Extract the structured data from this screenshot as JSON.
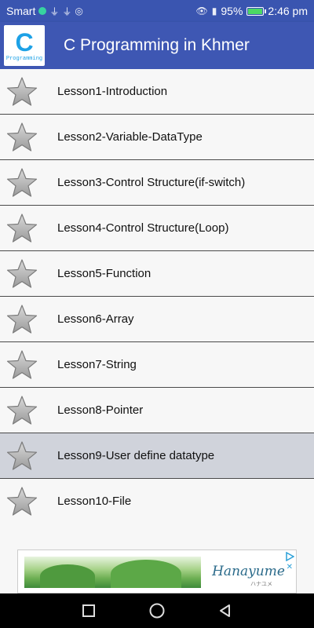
{
  "status_bar": {
    "carrier": "Smart",
    "battery_percent": "95%",
    "time": "2:46 pm",
    "battery_level": 0.95
  },
  "app_bar": {
    "logo_letter": "C",
    "logo_caption": "Programming",
    "title": "C Programming in Khmer"
  },
  "lessons": [
    {
      "label": "Lesson1-Introduction",
      "icon": "star-icon"
    },
    {
      "label": "Lesson2-Variable-DataType",
      "icon": "star-icon"
    },
    {
      "label": "Lesson3-Control Structure(if-switch)",
      "icon": "star-icon"
    },
    {
      "label": "Lesson4-Control Structure(Loop)",
      "icon": "star-icon"
    },
    {
      "label": "Lesson5-Function",
      "icon": "star-icon"
    },
    {
      "label": "Lesson6-Array",
      "icon": "star-icon"
    },
    {
      "label": "Lesson7-String",
      "icon": "star-icon"
    },
    {
      "label": "Lesson8-Pointer",
      "icon": "star-icon"
    },
    {
      "label": "Lesson9-User define datatype",
      "icon": "star-icon",
      "selected": true
    },
    {
      "label": "Lesson10-File",
      "icon": "star-icon"
    }
  ],
  "ad": {
    "brand": "Hanayume",
    "sub": "ハナユメ"
  },
  "colors": {
    "app_bar": "#3e57b3",
    "status_bar": "#3a55b0",
    "selected_row": "#d0d3db",
    "logo_accent": "#1da1e6"
  }
}
